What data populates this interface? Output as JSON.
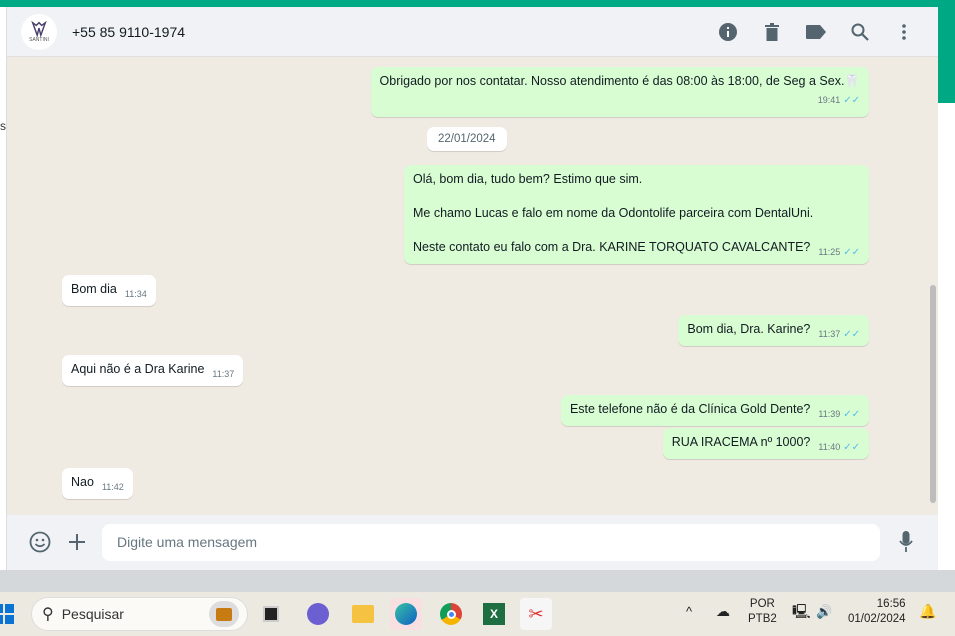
{
  "header": {
    "contact": "+55 85 9110-1974",
    "avatar_text": "SANTINI"
  },
  "left_strip_text": "s",
  "messages": [
    {
      "dir": "out",
      "lines": [
        "Obrigado por nos contatar. Nosso atendimento é das 08:00 às 18:00, de Seg a Sex.🦷"
      ],
      "time": "19:41"
    },
    {
      "dir": "out",
      "lines": [
        "Olá, bom dia, tudo bem? Estimo que sim.",
        "Me chamo Lucas e falo em nome da Odontolife parceira com DentalUni.",
        "Neste contato eu falo com a Dra.  KARINE TORQUATO CAVALCANTE?"
      ],
      "time": "11:25"
    },
    {
      "dir": "in",
      "lines": [
        "Bom dia"
      ],
      "time": "11:34"
    },
    {
      "dir": "out",
      "lines": [
        "Bom dia, Dra. Karine?"
      ],
      "time": "11:37"
    },
    {
      "dir": "in",
      "lines": [
        "Aqui não é a Dra Karine"
      ],
      "time": "11:37"
    },
    {
      "dir": "out",
      "lines": [
        "Este telefone não é da Clínica Gold Dente?"
      ],
      "time": "11:39"
    },
    {
      "dir": "out",
      "lines": [
        "RUA IRACEMA nº 1000?"
      ],
      "time": "11:40"
    },
    {
      "dir": "in",
      "lines": [
        "Nao"
      ],
      "time": "11:42"
    }
  ],
  "date_chip": "22/01/2024",
  "input": {
    "placeholder": "Digite uma mensagem"
  },
  "taskbar": {
    "search": "Pesquisar",
    "lang1": "POR",
    "lang2": "PTB2",
    "time": "16:56",
    "date": "01/02/2024"
  }
}
